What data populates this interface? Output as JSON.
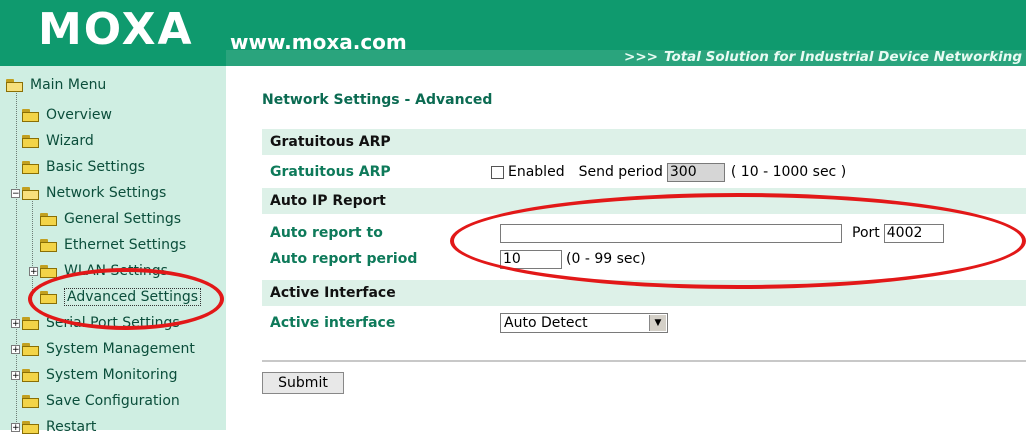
{
  "header": {
    "logo": "MOXA",
    "site": "www.moxa.com",
    "tagline_arrows": ">>>",
    "tagline": "Total Solution for Industrial Device Networking"
  },
  "sidebar": {
    "items": [
      {
        "label": "Main Menu"
      },
      {
        "label": "Overview"
      },
      {
        "label": "Wizard"
      },
      {
        "label": "Basic Settings"
      },
      {
        "label": "Network Settings"
      },
      {
        "label": "General Settings"
      },
      {
        "label": "Ethernet Settings"
      },
      {
        "label": "WLAN Settings"
      },
      {
        "label": "Advanced Settings"
      },
      {
        "label": "Serial Port Settings"
      },
      {
        "label": "System Management"
      },
      {
        "label": "System Monitoring"
      },
      {
        "label": "Save Configuration"
      },
      {
        "label": "Restart"
      }
    ],
    "expander_plus": "+",
    "expander_minus": "−"
  },
  "main": {
    "title": "Network Settings - Advanced",
    "gratuitous_arp": {
      "section": "Gratuitous ARP",
      "label": "Gratuitous ARP",
      "checkbox_label": "Enabled",
      "period_label": "Send period",
      "period_value": "300",
      "period_range": "( 10 - 1000 sec )"
    },
    "auto_ip": {
      "section": "Auto IP Report",
      "report_to_label": "Auto report to",
      "report_to_value": "",
      "port_label": "Port",
      "port_value": "4002",
      "period_label": "Auto report period",
      "period_value": "10",
      "period_range": "(0 - 99 sec)"
    },
    "active_interface": {
      "section": "Active Interface",
      "label": "Active interface",
      "selected": "Auto Detect"
    },
    "submit_label": "Submit"
  },
  "colors": {
    "header_green": "#0f9a6e",
    "sidebar_bg": "#cfeee2",
    "annotation_red": "#e21818"
  }
}
